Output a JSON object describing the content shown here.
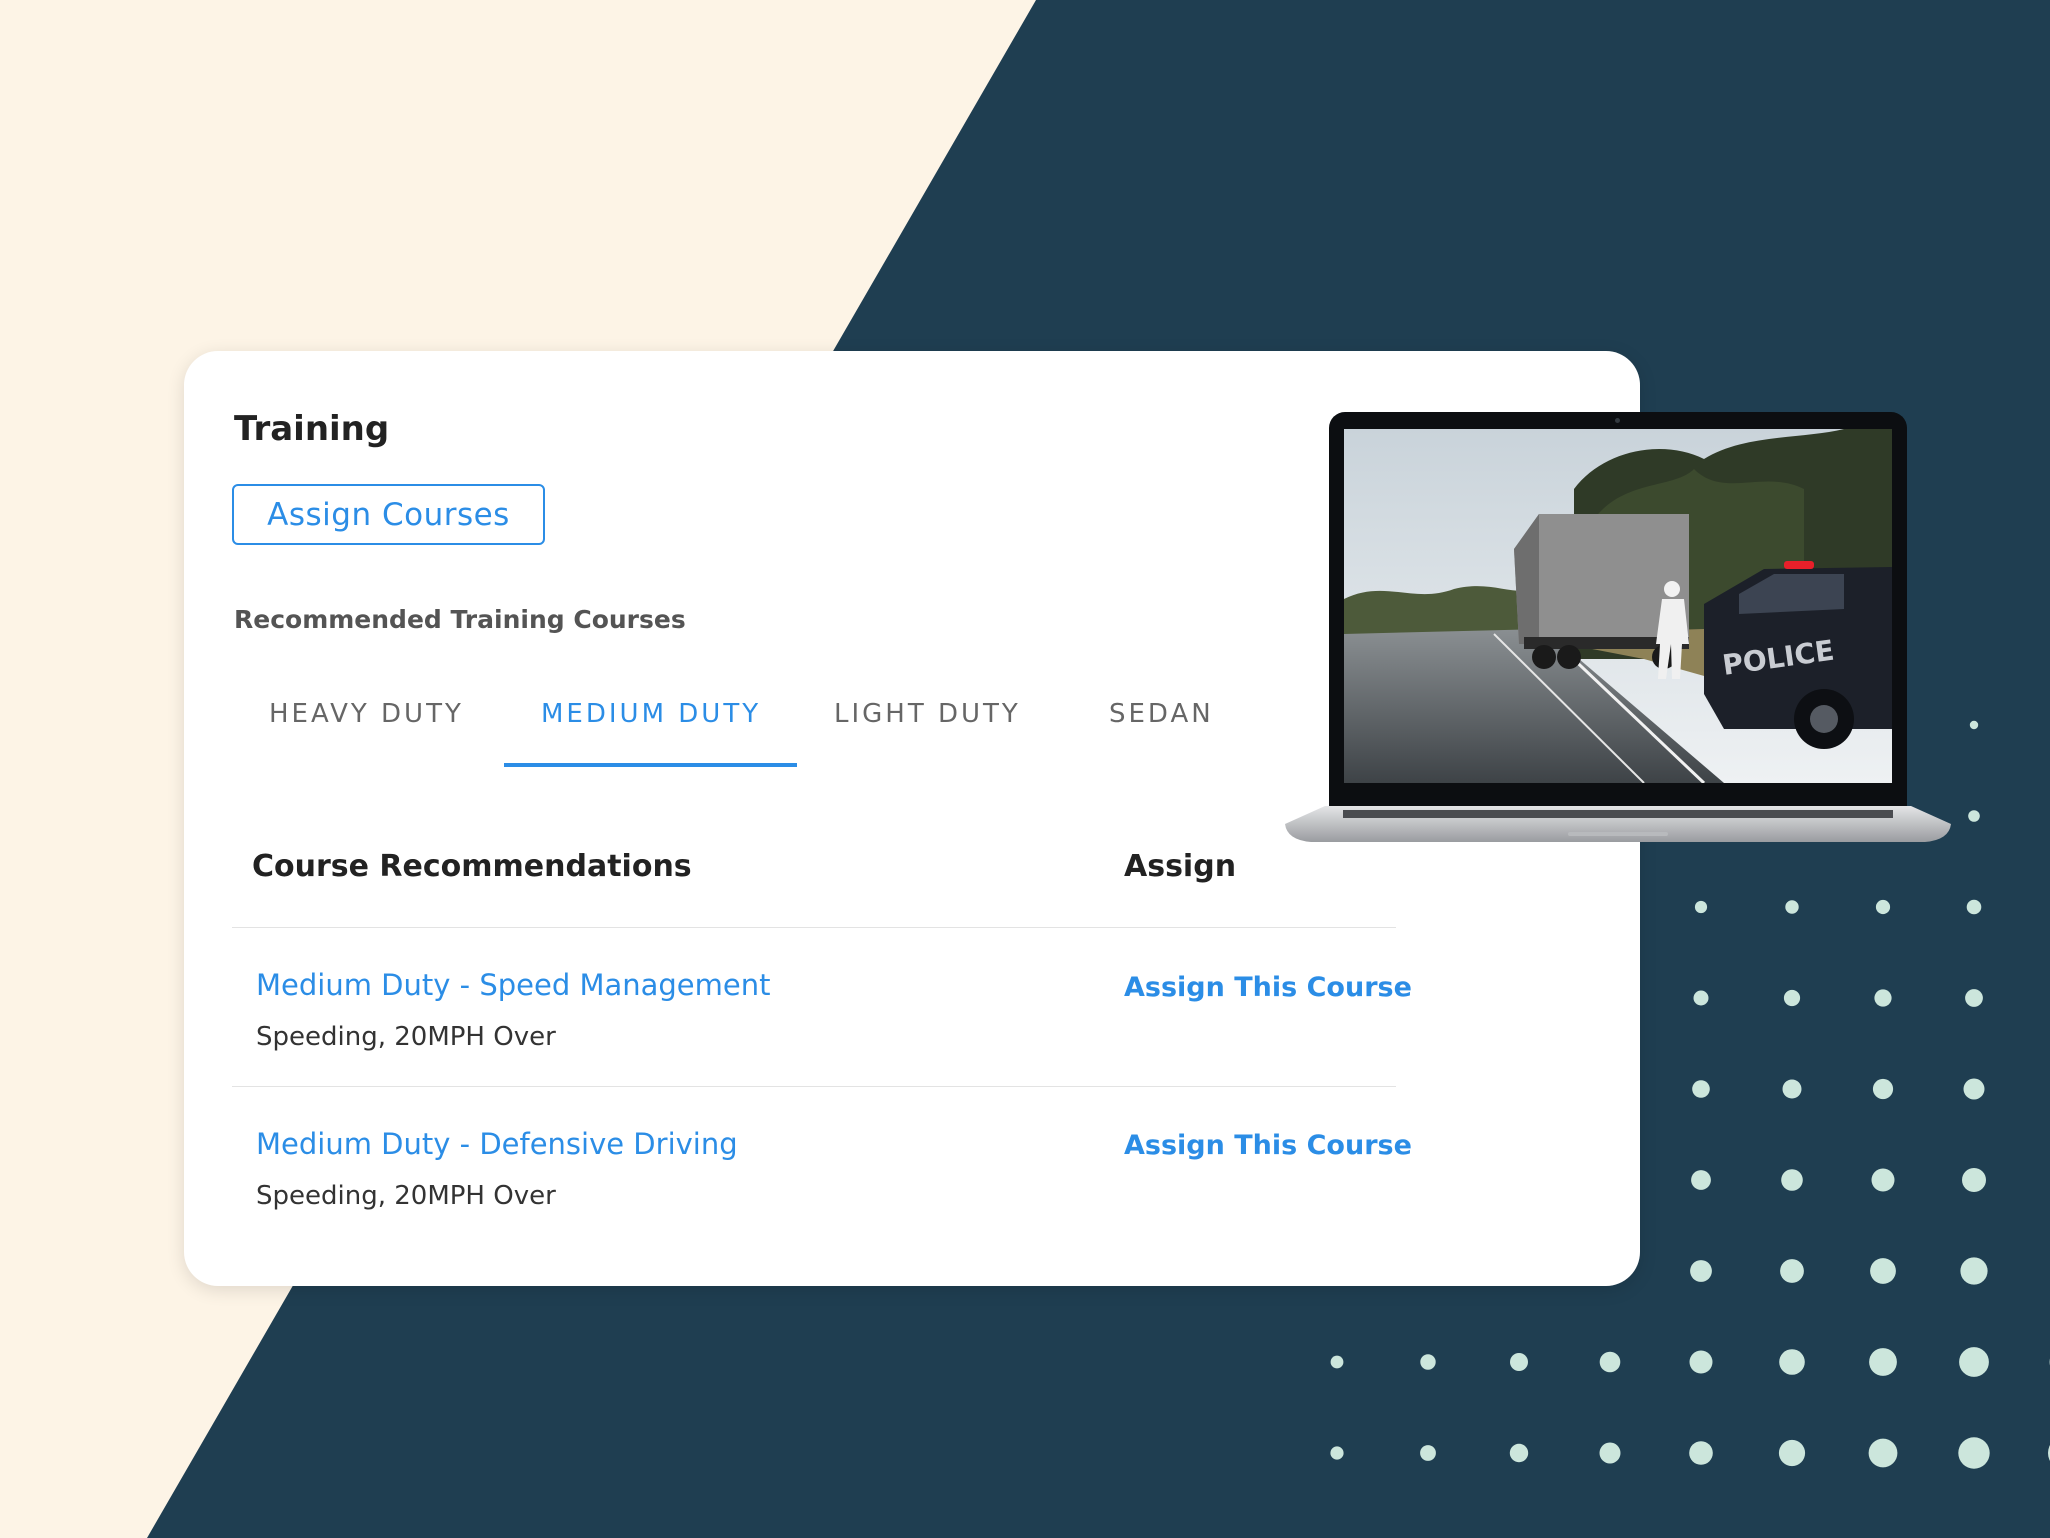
{
  "training": {
    "title": "Training",
    "assign_courses_label": "Assign Courses",
    "recommended_label": "Recommended Training Courses",
    "tabs": [
      {
        "label": "HEAVY DUTY",
        "active": false
      },
      {
        "label": "MEDIUM DUTY",
        "active": true
      },
      {
        "label": "LIGHT DUTY",
        "active": false
      },
      {
        "label": "SEDAN",
        "active": false
      }
    ],
    "table": {
      "headers": {
        "course": "Course Recommendations",
        "assign": "Assign"
      },
      "rows": [
        {
          "title": "Medium Duty - Speed Management",
          "subtitle": "Speeding, 20MPH Over",
          "action": "Assign This Course"
        },
        {
          "title": "Medium Duty - Defensive Driving",
          "subtitle": "Speeding, 20MPH Over",
          "action": "Assign This Course"
        }
      ]
    }
  },
  "laptop": {
    "screen_icon": "driving-simulation-scene",
    "scene_text": "POLICE"
  },
  "colors": {
    "background_navy": "#1f3e51",
    "background_cream": "#fdf4e6",
    "accent_blue": "#2b8de6",
    "dot_mint": "#cce6dc"
  }
}
